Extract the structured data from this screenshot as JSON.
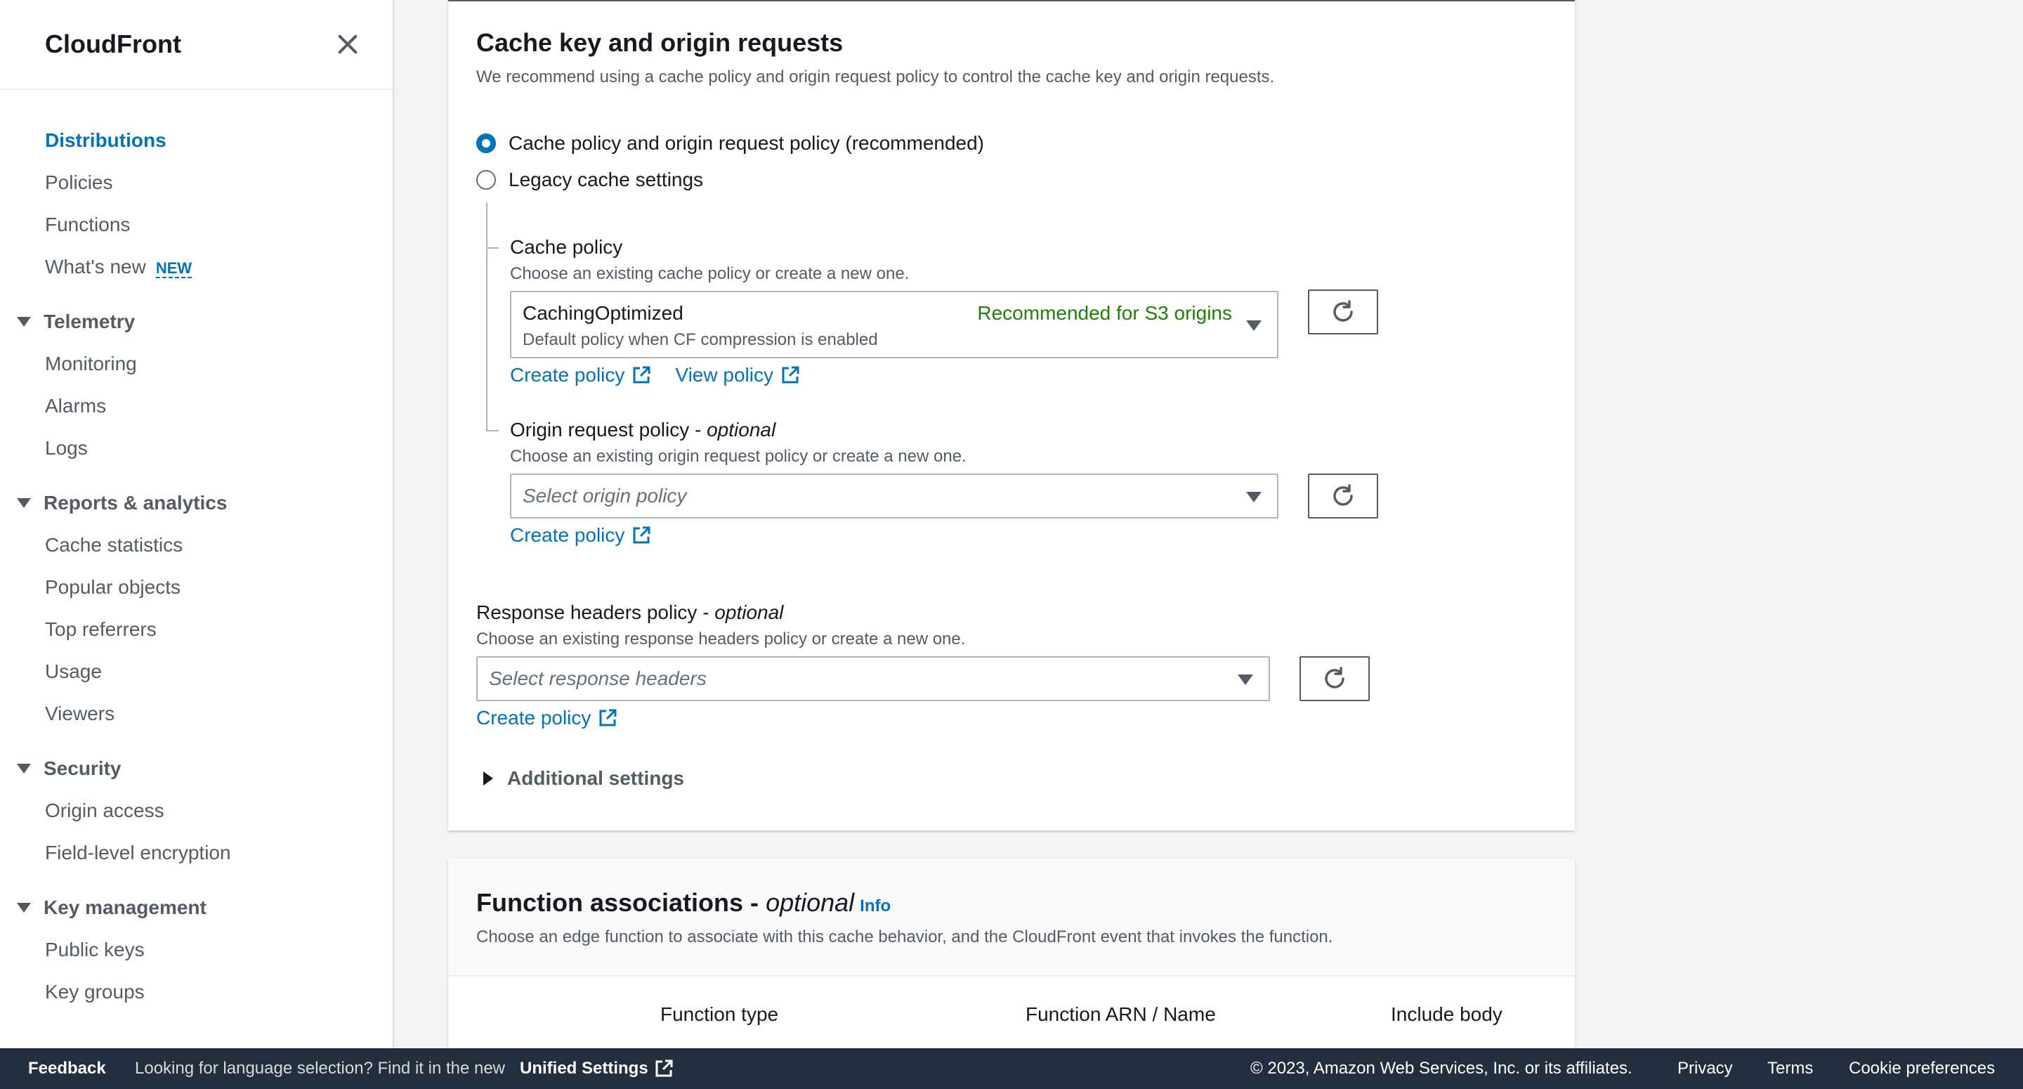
{
  "sidebar": {
    "title": "CloudFront",
    "items_top": [
      {
        "label": "Distributions",
        "active": true
      },
      {
        "label": "Policies"
      },
      {
        "label": "Functions"
      },
      {
        "label": "What's new",
        "badge": "NEW"
      }
    ],
    "sections": [
      {
        "title": "Telemetry",
        "items": [
          "Monitoring",
          "Alarms",
          "Logs"
        ]
      },
      {
        "title": "Reports & analytics",
        "items": [
          "Cache statistics",
          "Popular objects",
          "Top referrers",
          "Usage",
          "Viewers"
        ]
      },
      {
        "title": "Security",
        "items": [
          "Origin access",
          "Field-level encryption"
        ]
      },
      {
        "title": "Key management",
        "items": [
          "Public keys",
          "Key groups"
        ]
      }
    ]
  },
  "cache_section": {
    "title": "Cache key and origin requests",
    "description": "We recommend using a cache policy and origin request policy to control the cache key and origin requests.",
    "radio_recommended": "Cache policy and origin request policy (recommended)",
    "radio_legacy": "Legacy cache settings",
    "cache_policy": {
      "label": "Cache policy",
      "description": "Choose an existing cache policy or create a new one.",
      "selected": "CachingOptimized",
      "selected_note": "Recommended for S3 origins",
      "selected_sub": "Default policy when CF compression is enabled",
      "create_link": "Create policy",
      "view_link": "View policy"
    },
    "origin_request_policy": {
      "label": "Origin request policy - ",
      "label_optional": "optional",
      "description": "Choose an existing origin request policy or create a new one.",
      "placeholder": "Select origin policy",
      "create_link": "Create policy"
    },
    "response_headers_policy": {
      "label": "Response headers policy - ",
      "label_optional": "optional",
      "description": "Choose an existing response headers policy or create a new one.",
      "placeholder": "Select response headers",
      "create_link": "Create policy"
    },
    "additional_settings": "Additional settings"
  },
  "function_section": {
    "title": "Function associations - ",
    "title_optional": "optional",
    "info": "Info",
    "description": "Choose an edge function to associate with this cache behavior, and the CloudFront event that invokes the function.",
    "columns": [
      "Function type",
      "Function ARN / Name",
      "Include body"
    ]
  },
  "footer": {
    "feedback": "Feedback",
    "language_text": "Looking for language selection? Find it in the new",
    "unified_settings": "Unified Settings",
    "copyright": "© 2023, Amazon Web Services, Inc. or its affiliates.",
    "privacy": "Privacy",
    "terms": "Terms",
    "cookie": "Cookie preferences"
  },
  "colors": {
    "link": "#0073bb",
    "recommended": "#1d8102",
    "footer_bg": "#232f3e"
  }
}
